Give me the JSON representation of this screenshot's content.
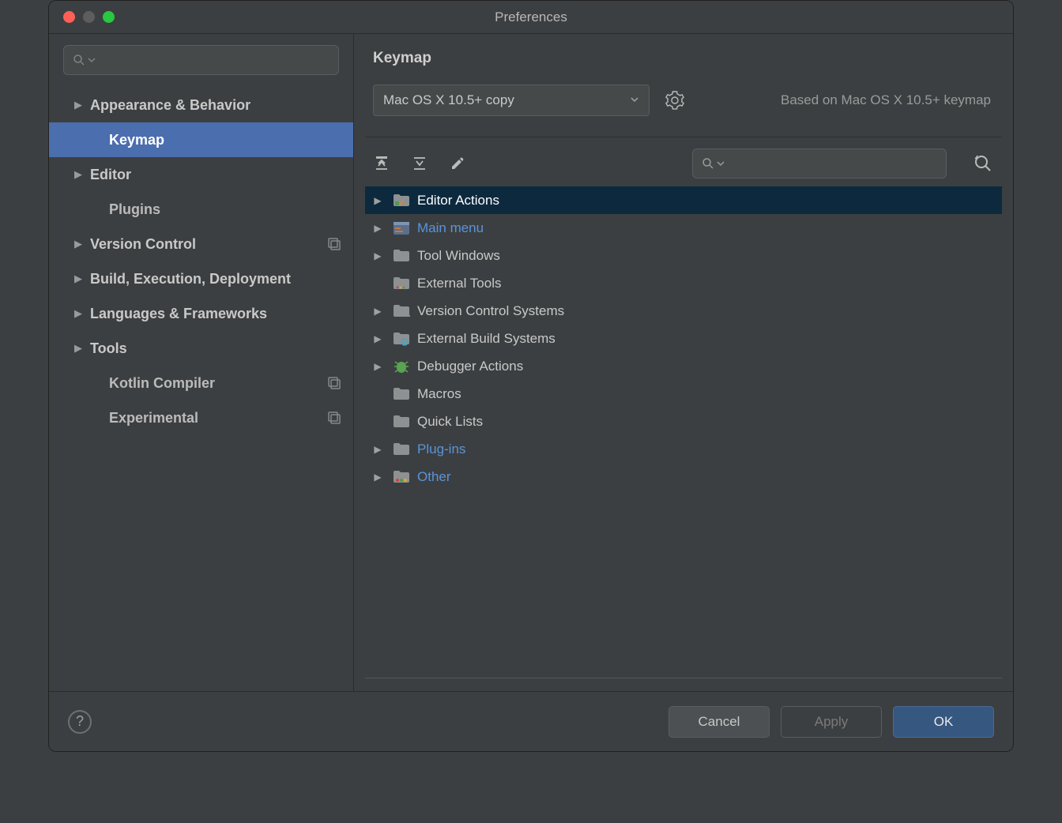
{
  "window": {
    "title": "Preferences"
  },
  "sidebar": {
    "search_placeholder": "",
    "items": [
      {
        "label": "Appearance & Behavior"
      },
      {
        "label": "Keymap"
      },
      {
        "label": "Editor"
      },
      {
        "label": "Plugins"
      },
      {
        "label": "Version Control"
      },
      {
        "label": "Build, Execution, Deployment"
      },
      {
        "label": "Languages & Frameworks"
      },
      {
        "label": "Tools"
      },
      {
        "label": "Kotlin Compiler"
      },
      {
        "label": "Experimental"
      }
    ]
  },
  "main": {
    "breadcrumb": "Keymap",
    "keymap_selected": "Mac OS X 10.5+ copy",
    "based_on": "Based on Mac OS X 10.5+ keymap",
    "action_search_placeholder": "",
    "tree": [
      {
        "label": "Editor Actions",
        "icon": "folder-editor-icon",
        "expandable": true,
        "selected": true
      },
      {
        "label": "Main menu",
        "icon": "menu-icon",
        "expandable": true,
        "link": true
      },
      {
        "label": "Tool Windows",
        "icon": "folder-icon",
        "expandable": true
      },
      {
        "label": "External Tools",
        "icon": "external-tools-icon",
        "expandable": false
      },
      {
        "label": "Version Control Systems",
        "icon": "folder-icon",
        "expandable": true
      },
      {
        "label": "External Build Systems",
        "icon": "folder-gear-icon",
        "expandable": true
      },
      {
        "label": "Debugger Actions",
        "icon": "bug-icon",
        "expandable": true
      },
      {
        "label": "Macros",
        "icon": "folder-icon",
        "expandable": false
      },
      {
        "label": "Quick Lists",
        "icon": "folder-icon",
        "expandable": false
      },
      {
        "label": "Plug-ins",
        "icon": "folder-icon",
        "expandable": true,
        "link": true
      },
      {
        "label": "Other",
        "icon": "folder-misc-icon",
        "expandable": true,
        "link": true
      }
    ]
  },
  "footer": {
    "cancel": "Cancel",
    "apply": "Apply",
    "ok": "OK"
  },
  "colors": {
    "bg": "#3c3f41",
    "accent": "#4b6eaf",
    "selection": "#0d293e",
    "link": "#5994db",
    "text": "#bbbbbb",
    "border": "#5a5d5e"
  }
}
